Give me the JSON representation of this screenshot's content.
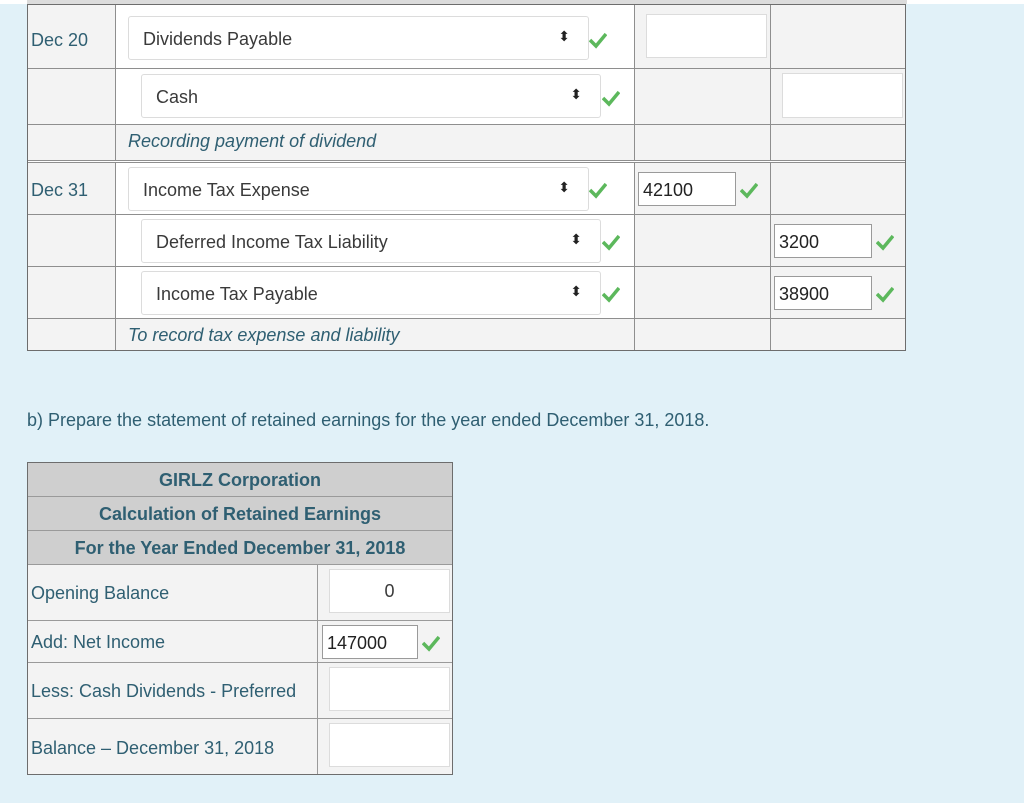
{
  "journal": {
    "entries": [
      {
        "date": "Dec 20",
        "debit_account": "Dividends Payable",
        "debit_amount": "",
        "credit_accounts": [
          {
            "account": "Cash",
            "amount": ""
          }
        ],
        "memo": "Recording payment of dividend"
      },
      {
        "date": "Dec 31",
        "debit_account": "Income Tax Expense",
        "debit_amount": "42100",
        "credit_accounts": [
          {
            "account": "Deferred Income Tax Liability",
            "amount": "3200"
          },
          {
            "account": "Income Tax Payable",
            "amount": "38900"
          }
        ],
        "memo": "To record tax expense and liability"
      }
    ],
    "select_arrow_glyph": "⬍",
    "check_color": "#5cb85c"
  },
  "instruction": "b) Prepare the statement of retained earnings for the year ended December 31, 2018.",
  "retained_earnings": {
    "company": "GIRLZ Corporation",
    "title": "Calculation of Retained Earnings",
    "period": "For the Year Ended December 31, 2018",
    "rows": [
      {
        "label": "Opening Balance",
        "value": "0"
      },
      {
        "label": "Add: Net Income",
        "value": "147000"
      },
      {
        "label": "Less: Cash Dividends - Preferred",
        "value": ""
      },
      {
        "label": "Balance – December 31, 2018",
        "value": ""
      }
    ]
  }
}
